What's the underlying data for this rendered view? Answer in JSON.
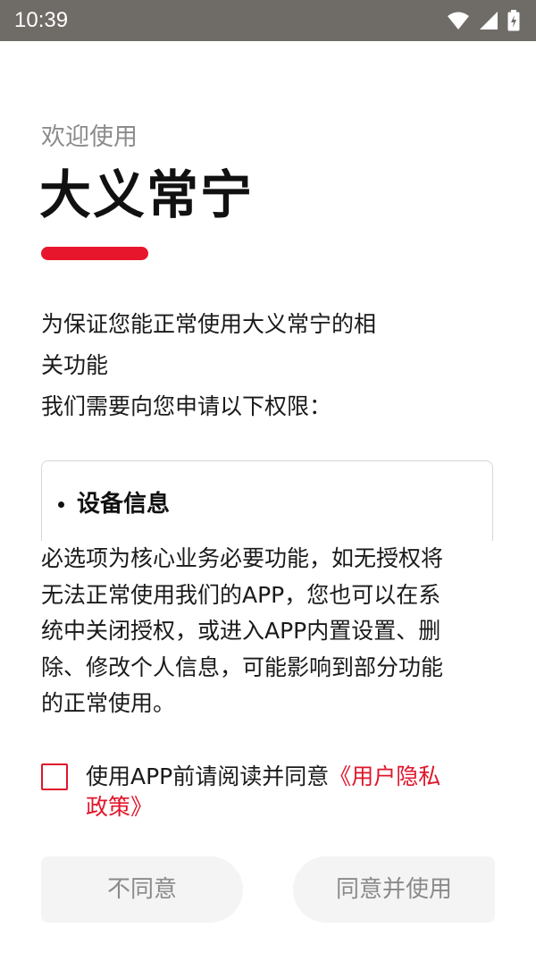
{
  "status_bar": {
    "time": "10:39",
    "icons": [
      "wifi-icon",
      "signal-icon",
      "battery-charging-icon"
    ]
  },
  "welcome": {
    "greeting": "欢迎使用",
    "app_name": "大义常宁",
    "accent_color": "#e8162c"
  },
  "intro": {
    "line1": "为保证您能正常使用大义常宁的相",
    "line2": "关功能",
    "line3": "我们需要向您申请以下权限："
  },
  "permissions": {
    "items": [
      {
        "label": "设备信息"
      }
    ]
  },
  "notice": {
    "line1": "必选项为核心业务必要功能，如无授权将",
    "line2": "无法正常使用我们的APP，您也可以在系",
    "line3": "统中关闭授权，或进入APP内置设置、删",
    "line4": "除、修改个人信息，可能影响到部分功能",
    "line5": "的正常使用。"
  },
  "agreement": {
    "checked": false,
    "text": "使用APP前请阅读并同意",
    "link_part1": "《用户隐私",
    "link_part2": "政策》",
    "link_color": "#e0162b"
  },
  "buttons": {
    "disagree_label": "不同意",
    "agree_label": "同意并使用"
  }
}
